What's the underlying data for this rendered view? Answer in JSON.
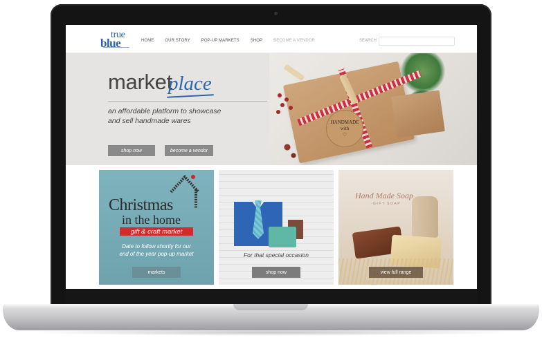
{
  "nav": {
    "logo_top": "true",
    "logo_bottom": "blue",
    "items": [
      "HOME",
      "OUR STORY",
      "POP-UP MARKETS",
      "SHOP",
      "BECOME A VENDOR"
    ],
    "search_label": "SEARCH",
    "search_placeholder": ""
  },
  "hero": {
    "title_main": "market",
    "title_script": "place",
    "subtitle_line1": "an affordable platform to showcase",
    "subtitle_line2": "and sell handmade wares",
    "shop_button": "shop now",
    "vendor_button": "become a vendor",
    "tag_line1": "HANDMADE",
    "tag_line2": "with",
    "tag_line3": "♡"
  },
  "panels": {
    "christmas": {
      "title_line1": "Christmas",
      "title_line2": "in the home",
      "banner": "gift & craft market",
      "note_line1": "Date to follow shortly for our",
      "note_line2": "end of the year pop-up market",
      "button": "markets"
    },
    "occasion": {
      "caption": "For that special occasion",
      "button": "shop now"
    },
    "soap": {
      "brand": "Hand Made Soap",
      "brand_sub": "GIFT SOAP",
      "button": "view full range"
    }
  },
  "colors": {
    "brand_blue": "#2f66a8",
    "button_grey": "#8a8a8a",
    "christmas_red": "#d32a30",
    "panel_teal": "#7fb3be"
  }
}
